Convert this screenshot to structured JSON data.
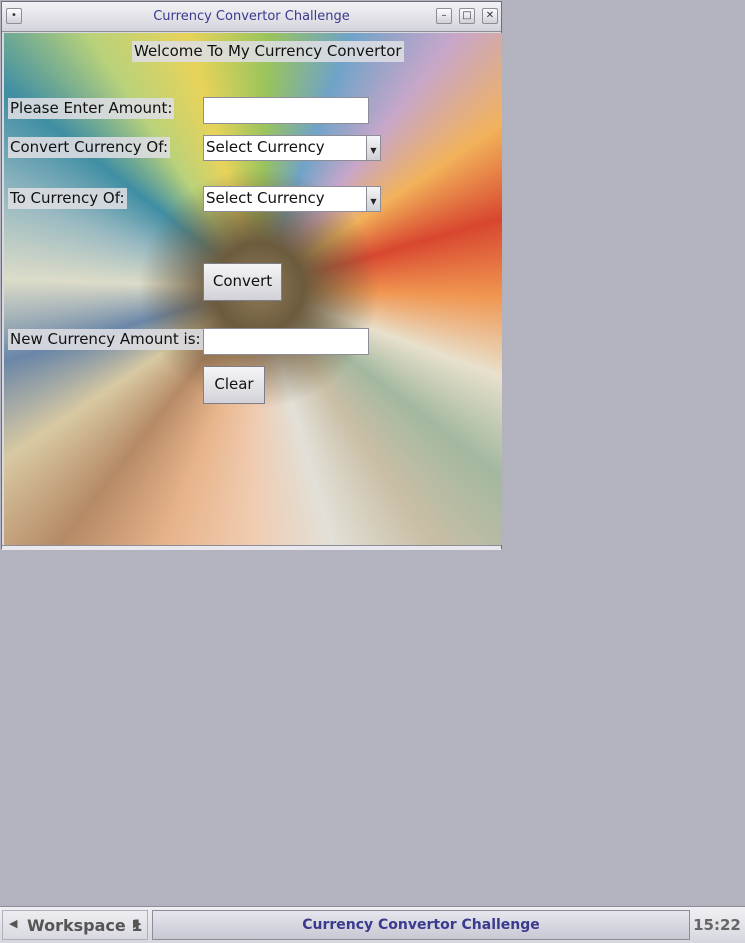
{
  "window": {
    "title": "Currency Convertor Challenge",
    "menu_glyph": "•",
    "minimize_glyph": "–",
    "maximize_glyph": "□",
    "close_glyph": "✕"
  },
  "form": {
    "welcome": "Welcome To My Currency Convertor",
    "amount_label": "Please Enter Amount:",
    "amount_value": "",
    "from_label": "Convert Currency Of:",
    "from_selected": "Select Currency",
    "to_label": "To Currency Of:",
    "to_selected": "Select Currency",
    "convert_button": "Convert",
    "result_label": "New Currency Amount is:",
    "result_value": "",
    "clear_button": "Clear",
    "dropdown_glyph": "▼"
  },
  "taskbar": {
    "workspace_label": "Workspace 1",
    "prev_glyph": "◀",
    "next_glyph": "▶",
    "task_title": "Currency Convertor Challenge",
    "clock": "15:22"
  },
  "colors": {
    "desktop": "#b3b3c0",
    "title_text": "#3a3a8e"
  }
}
